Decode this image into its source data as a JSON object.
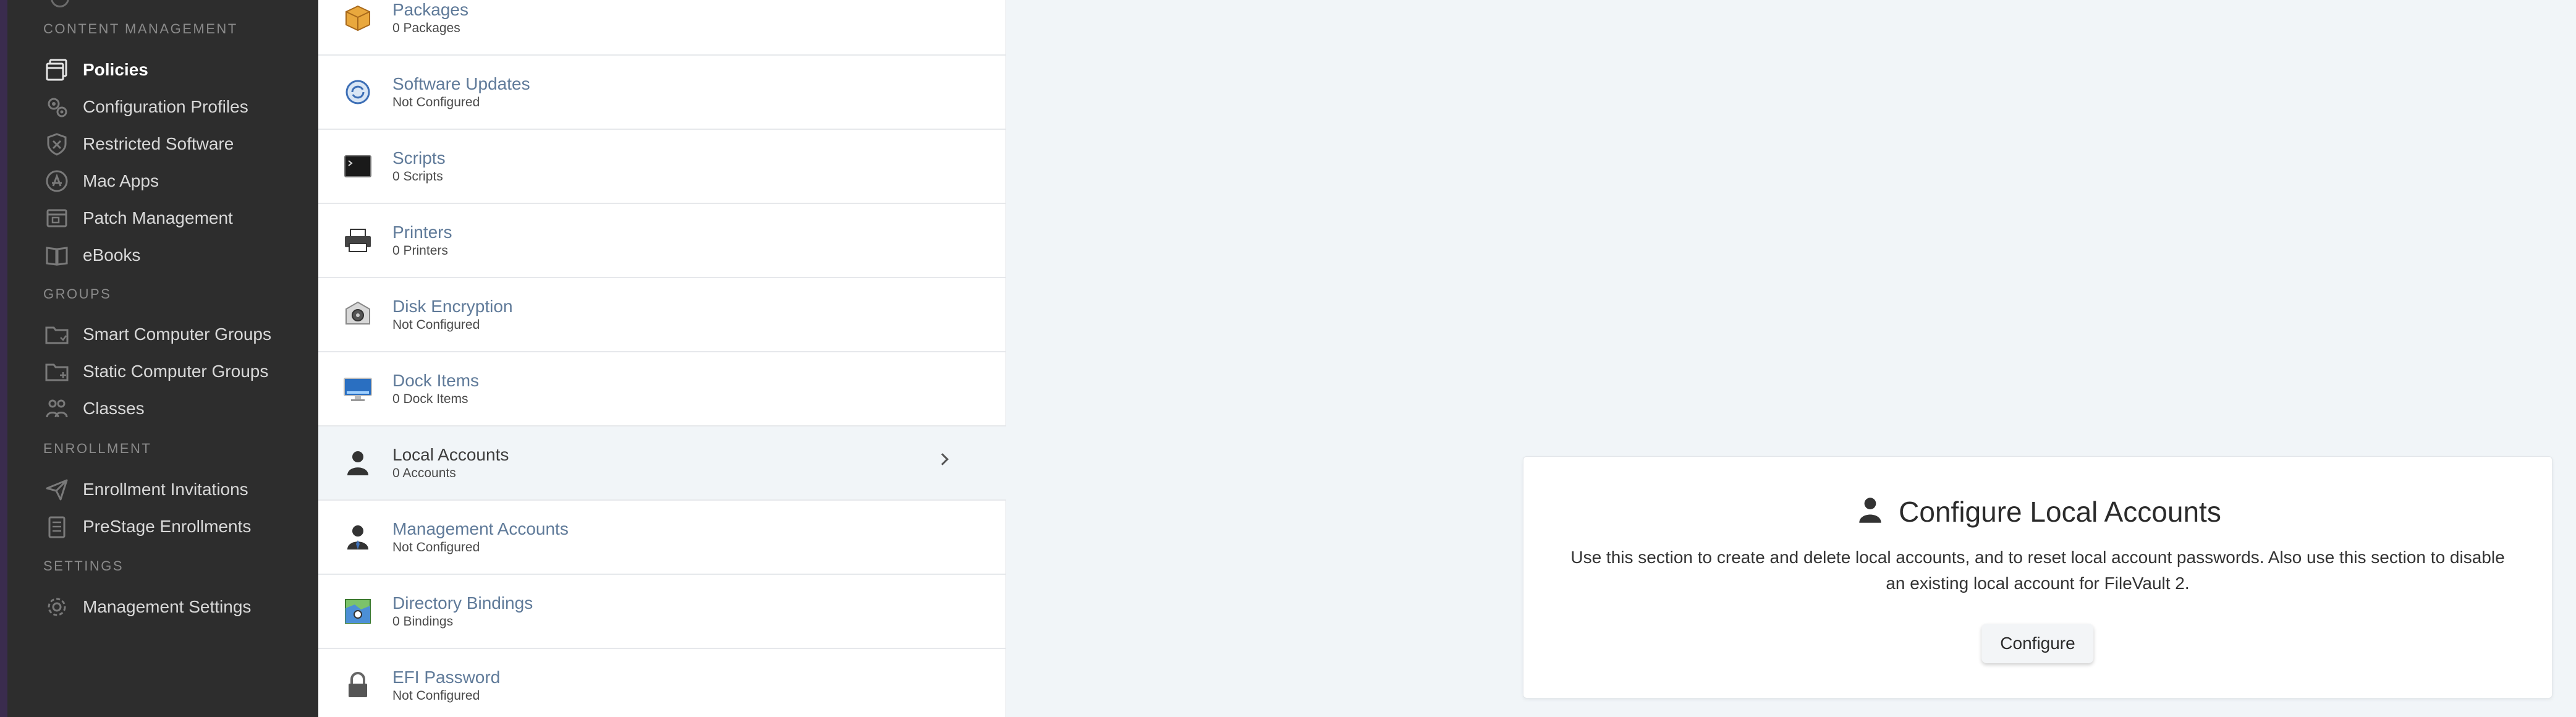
{
  "sidebar": {
    "sections": {
      "content_management": "Content Management",
      "groups": "Groups",
      "enrollment": "Enrollment",
      "settings": "Settings"
    },
    "items": {
      "policies": "Policies",
      "configuration_profiles": "Configuration Profiles",
      "restricted_software": "Restricted Software",
      "mac_apps": "Mac Apps",
      "patch_management": "Patch Management",
      "ebooks": "eBooks",
      "smart_computer_groups": "Smart Computer Groups",
      "static_computer_groups": "Static Computer Groups",
      "classes": "Classes",
      "enrollment_invitations": "Enrollment Invitations",
      "prestage_enrollments": "PreStage Enrollments",
      "management_settings": "Management Settings"
    },
    "active_item": "Policies"
  },
  "list": {
    "rows": [
      {
        "title": "Packages",
        "subtitle": "0 Packages"
      },
      {
        "title": "Software Updates",
        "subtitle": "Not Configured"
      },
      {
        "title": "Scripts",
        "subtitle": "0 Scripts"
      },
      {
        "title": "Printers",
        "subtitle": "0 Printers"
      },
      {
        "title": "Disk Encryption",
        "subtitle": "Not Configured"
      },
      {
        "title": "Dock Items",
        "subtitle": "0 Dock Items"
      },
      {
        "title": "Local Accounts",
        "subtitle": "0 Accounts"
      },
      {
        "title": "Management Accounts",
        "subtitle": "Not Configured"
      },
      {
        "title": "Directory Bindings",
        "subtitle": "0 Bindings"
      },
      {
        "title": "EFI Password",
        "subtitle": "Not Configured"
      }
    ],
    "selected_row": "Local Accounts"
  },
  "detail": {
    "title": "Configure Local Accounts",
    "description": "Use this section to create and delete local accounts, and to reset local account passwords. Also use this section to disable an existing local account for FileVault 2.",
    "button_label": "Configure"
  },
  "colors": {
    "sidebar_bg": "#2d2d2d",
    "sidebar_edge": "#3a2c4e",
    "link_text": "#5f7a99",
    "page_bg": "#f1f5f8"
  }
}
